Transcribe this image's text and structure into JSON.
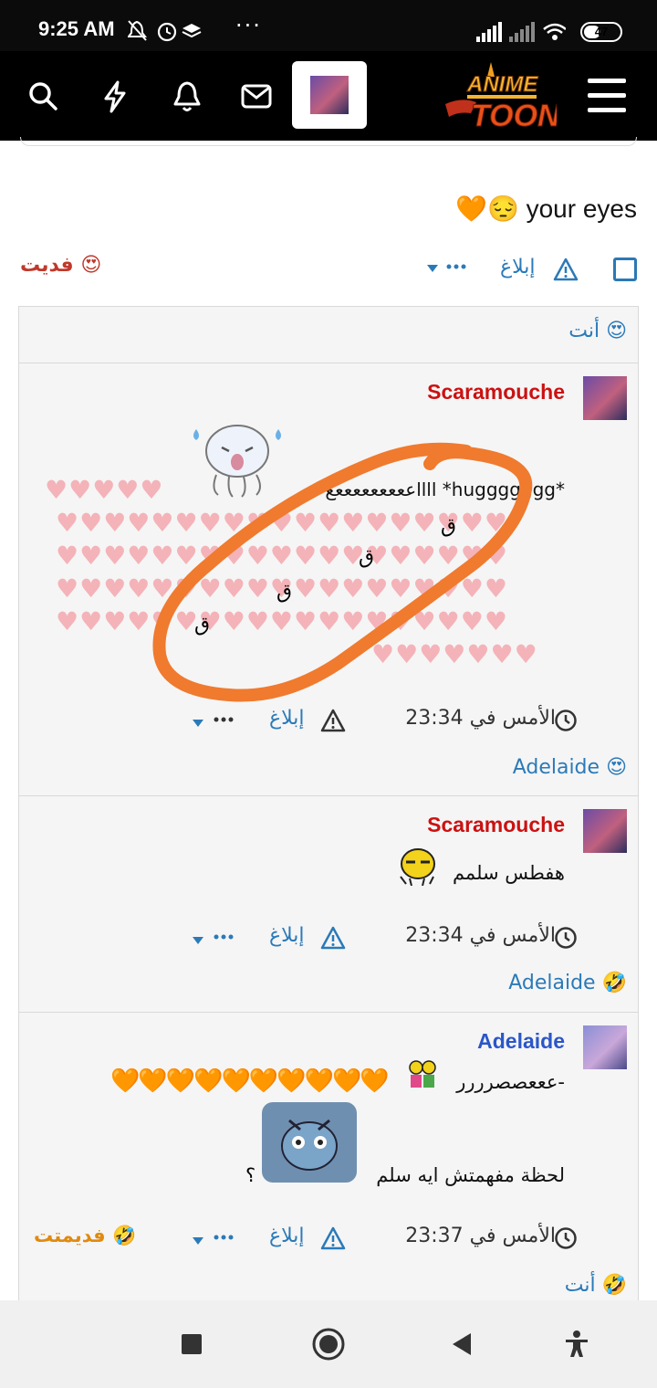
{
  "status_bar": {
    "time": "9:25 AM",
    "battery": "47",
    "battery_level": 0.47
  },
  "nav": {
    "icons": [
      "search-icon",
      "bolt-icon",
      "bell-icon",
      "mail-icon"
    ],
    "logo_top": "ANIME",
    "logo_bottom": "TOON"
  },
  "post": {
    "text_tail": "your eyes",
    "reaction_label": "فديت",
    "report_label": "إبلاغ"
  },
  "comments_header": {
    "reactor": "أنت"
  },
  "comments": [
    {
      "user": "Scaramouche",
      "user_color": "#cc1111",
      "line1": "ااااعععععععععع *huggggggg*",
      "letters": [
        "ق",
        "ق",
        "ق",
        "ق"
      ],
      "time": "الأمس في 23:34",
      "report": "إبلاغ",
      "reactor": "Adelaide"
    },
    {
      "user": "Scaramouche",
      "user_color": "#cc1111",
      "text": "هفطس سلمم",
      "time": "الأمس في 23:34",
      "report": "إبلاغ",
      "reactor": "Adelaide"
    },
    {
      "user": "Adelaide",
      "user_color": "#2b56c9",
      "line1": "-عععصصرررر",
      "line2": "لحظة مفهمتش ايه سلم",
      "q": "؟",
      "time": "الأمس في 23:37",
      "report": "إبلاغ",
      "reaction": "فديمتت",
      "reactor": "أنت"
    }
  ]
}
